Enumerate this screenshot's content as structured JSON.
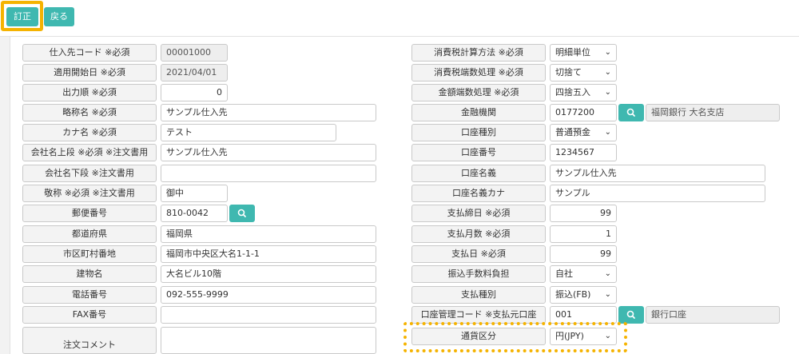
{
  "toolbar": {
    "correct_label": "訂正",
    "back_label": "戻る"
  },
  "left": [
    {
      "label": "仕入先コード ※必須",
      "value": "00001000"
    },
    {
      "label": "適用開始日 ※必須",
      "value": "2021/04/01"
    },
    {
      "label": "出力順 ※必須",
      "value": "0"
    },
    {
      "label": "略称名 ※必須",
      "value": "サンプル仕入先"
    },
    {
      "label": "カナ名 ※必須",
      "value": "テスト"
    },
    {
      "label": "会社名上段 ※必須 ※注文書用",
      "value": "サンプル仕入先"
    },
    {
      "label": "会社名下段 ※注文書用",
      "value": ""
    },
    {
      "label": "敬称 ※必須 ※注文書用",
      "value": "御中"
    },
    {
      "label": "郵便番号",
      "value": "810-0042"
    },
    {
      "label": "都道府県",
      "value": "福岡県"
    },
    {
      "label": "市区町村番地",
      "value": "福岡市中央区大名1-1-1"
    },
    {
      "label": "建物名",
      "value": "大名ビル10階"
    },
    {
      "label": "電話番号",
      "value": "092-555-9999"
    },
    {
      "label": "FAX番号",
      "value": ""
    },
    {
      "label": "注文コメント",
      "value": ""
    }
  ],
  "right": [
    {
      "label": "消費税計算方法 ※必須",
      "value": "明細単位"
    },
    {
      "label": "消費税端数処理 ※必須",
      "value": "切捨て"
    },
    {
      "label": "金額端数処理 ※必須",
      "value": "四捨五入"
    },
    {
      "label": "金融機関",
      "value": "0177200",
      "extra": "福岡銀行 大名支店"
    },
    {
      "label": "口座種別",
      "value": "普通預金"
    },
    {
      "label": "口座番号",
      "value": "1234567"
    },
    {
      "label": "口座名義",
      "value": "サンプル仕入先"
    },
    {
      "label": "口座名義カナ",
      "value": "サンプル"
    },
    {
      "label": "支払締日 ※必須",
      "value": "99"
    },
    {
      "label": "支払月数 ※必須",
      "value": "1"
    },
    {
      "label": "支払日 ※必須",
      "value": "99"
    },
    {
      "label": "振込手数料負担",
      "value": "自社"
    },
    {
      "label": "支払種別",
      "value": "振込(FB)"
    },
    {
      "label": "口座管理コード ※支払元口座",
      "value": "001",
      "extra": "銀行口座"
    },
    {
      "label": "通貨区分",
      "value": "円(JPY)"
    }
  ],
  "icons": {
    "search": "search-icon",
    "dropdown": "chevron-down-icon"
  },
  "colors": {
    "accent": "#3fb8b0",
    "highlight": "#f5b301"
  }
}
